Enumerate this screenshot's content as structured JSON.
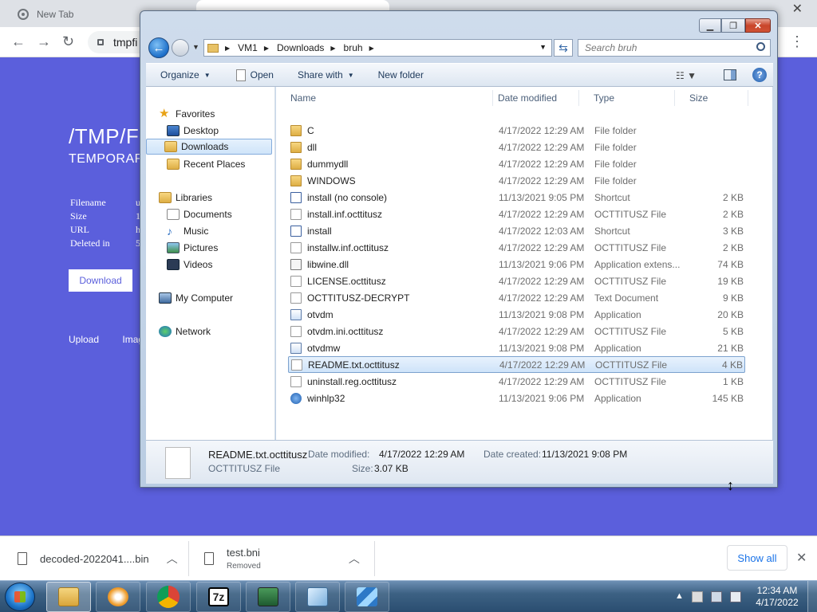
{
  "browser": {
    "tab_title": "New Tab",
    "url_fragment": "tmpfi",
    "menu_icon": "more-vert-icon"
  },
  "webpage": {
    "title": "/TMP/FI",
    "subtitle": "TEMPORAR",
    "meta_labels": [
      "Filename",
      "Size",
      "URL",
      "Deleted in"
    ],
    "meta_values": [
      "u",
      "1",
      "h",
      "5"
    ],
    "download_label": "Download",
    "links": [
      "Upload",
      "Imag"
    ]
  },
  "downloads_shelf": {
    "items": [
      {
        "name": "decoded-2022041....bin",
        "status": ""
      },
      {
        "name": "test.bni",
        "status": "Removed"
      }
    ],
    "show_all": "Show all"
  },
  "explorer": {
    "breadcrumb": [
      "VM1",
      "Downloads",
      "bruh"
    ],
    "search_placeholder": "Search bruh",
    "commands": {
      "organize": "Organize",
      "open": "Open",
      "share_with": "Share with",
      "new_folder": "New folder"
    },
    "nav": {
      "favorites": "Favorites",
      "desktop": "Desktop",
      "downloads": "Downloads",
      "recent_places": "Recent Places",
      "libraries": "Libraries",
      "documents": "Documents",
      "music": "Music",
      "pictures": "Pictures",
      "videos": "Videos",
      "my_computer": "My Computer",
      "network": "Network"
    },
    "columns": {
      "name": "Name",
      "date": "Date modified",
      "type": "Type",
      "size": "Size"
    },
    "files": [
      {
        "name": "C",
        "date": "4/17/2022 12:29 AM",
        "type": "File folder",
        "size": "",
        "icon": "folder"
      },
      {
        "name": "dll",
        "date": "4/17/2022 12:29 AM",
        "type": "File folder",
        "size": "",
        "icon": "folder"
      },
      {
        "name": "dummydll",
        "date": "4/17/2022 12:29 AM",
        "type": "File folder",
        "size": "",
        "icon": "folder"
      },
      {
        "name": "WINDOWS",
        "date": "4/17/2022 12:29 AM",
        "type": "File folder",
        "size": "",
        "icon": "folder"
      },
      {
        "name": "install (no console)",
        "date": "11/13/2021 9:05 PM",
        "type": "Shortcut",
        "size": "2 KB",
        "icon": "shortcut"
      },
      {
        "name": "install.inf.octtitusz",
        "date": "4/17/2022 12:29 AM",
        "type": "OCTTITUSZ File",
        "size": "2 KB",
        "icon": "doc"
      },
      {
        "name": "install",
        "date": "4/17/2022 12:03 AM",
        "type": "Shortcut",
        "size": "3 KB",
        "icon": "shortcut"
      },
      {
        "name": "installw.inf.octtitusz",
        "date": "4/17/2022 12:29 AM",
        "type": "OCTTITUSZ File",
        "size": "2 KB",
        "icon": "doc"
      },
      {
        "name": "libwine.dll",
        "date": "11/13/2021 9:06 PM",
        "type": "Application extens...",
        "size": "74 KB",
        "icon": "dll"
      },
      {
        "name": "LICENSE.octtitusz",
        "date": "4/17/2022 12:29 AM",
        "type": "OCTTITUSZ File",
        "size": "19 KB",
        "icon": "doc"
      },
      {
        "name": "OCTTITUSZ-DECRYPT",
        "date": "4/17/2022 12:29 AM",
        "type": "Text Document",
        "size": "9 KB",
        "icon": "doc"
      },
      {
        "name": "otvdm",
        "date": "11/13/2021 9:08 PM",
        "type": "Application",
        "size": "20 KB",
        "icon": "app"
      },
      {
        "name": "otvdm.ini.octtitusz",
        "date": "4/17/2022 12:29 AM",
        "type": "OCTTITUSZ File",
        "size": "5 KB",
        "icon": "doc"
      },
      {
        "name": "otvdmw",
        "date": "11/13/2021 9:08 PM",
        "type": "Application",
        "size": "21 KB",
        "icon": "app"
      },
      {
        "name": "README.txt.octtitusz",
        "date": "4/17/2022 12:29 AM",
        "type": "OCTTITUSZ File",
        "size": "4 KB",
        "icon": "doc"
      },
      {
        "name": "uninstall.reg.octtitusz",
        "date": "4/17/2022 12:29 AM",
        "type": "OCTTITUSZ File",
        "size": "1 KB",
        "icon": "doc"
      },
      {
        "name": "winhlp32",
        "date": "11/13/2021 9:06 PM",
        "type": "Application",
        "size": "145 KB",
        "icon": "help"
      }
    ],
    "selected_index": 14,
    "details": {
      "file_name": "README.txt.octtitusz",
      "file_type": "OCTTITUSZ File",
      "date_modified_label": "Date modified:",
      "date_modified": "4/17/2022 12:29 AM",
      "date_created_label": "Date created:",
      "date_created": "11/13/2021 9:08 PM",
      "size_label": "Size:",
      "size": "3.07 KB"
    }
  },
  "taskbar": {
    "clock_time": "12:34 AM",
    "clock_date": "4/17/2022",
    "buttons": [
      "explorer-icon",
      "media-player-icon",
      "chrome-icon",
      "7zip-icon",
      "computer-icon",
      "notepad-icon",
      "package-icon"
    ]
  }
}
